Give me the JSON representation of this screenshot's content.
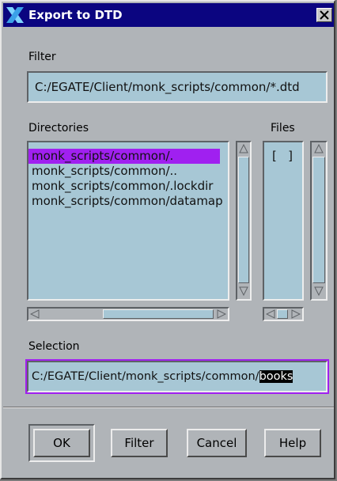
{
  "window": {
    "title": "Export to DTD",
    "close_glyph": "✕"
  },
  "filter": {
    "label": "Filter",
    "value": "C:/EGATE/Client/monk_scripts/common/*.dtd"
  },
  "directories": {
    "label": "Directories",
    "items": [
      {
        "text": "monk_scripts/common/.",
        "selected": true
      },
      {
        "text": "monk_scripts/common/..",
        "selected": false
      },
      {
        "text": "monk_scripts/common/.lockdir",
        "selected": false
      },
      {
        "text": "monk_scripts/common/datamap",
        "selected": false
      }
    ]
  },
  "files": {
    "label": "Files",
    "items": [
      {
        "text": "[   ]"
      }
    ]
  },
  "selection": {
    "label": "Selection",
    "value_prefix": "C:/EGATE/Client/monk_scripts/common/",
    "value_highlight": "books"
  },
  "buttons": {
    "ok": "OK",
    "filter": "Filter",
    "cancel": "Cancel",
    "help": "Help"
  },
  "colors": {
    "titlebar": "#0b0580",
    "field_bg": "#a7c7d5",
    "selection_accent": "#a020f0",
    "dialog_bg": "#b0b4b8"
  },
  "icons": {
    "app": "x-logo-icon",
    "close": "close-icon"
  }
}
